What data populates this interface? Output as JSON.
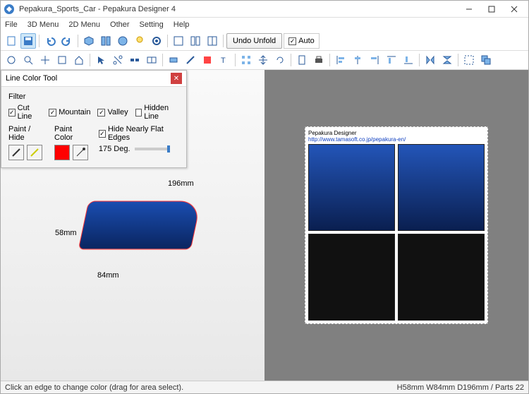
{
  "window": {
    "title": "Pepakura_Sports_Car - Pepakura Designer 4"
  },
  "menu": {
    "file": "File",
    "menu3d": "3D Menu",
    "menu2d": "2D Menu",
    "other": "Other",
    "setting": "Setting",
    "help": "Help"
  },
  "toolbar": {
    "undo_unfold": "Undo Unfold",
    "auto": "Auto"
  },
  "panel": {
    "title": "Line Color Tool",
    "filter_label": "Filter",
    "cut_line": "Cut Line",
    "mountain": "Mountain",
    "valley": "Valley",
    "hidden_line": "Hidden Line",
    "paint_hide": "Paint / Hide",
    "paint_color": "Paint Color",
    "hide_nearly_flat": "Hide Nearly Flat Edges",
    "deg": "175 Deg."
  },
  "model": {
    "length": "196mm",
    "height": "58mm",
    "width": "84mm"
  },
  "sheet": {
    "header": "Pepakura Designer",
    "link": "http://www.tamasoft.co.jp/pepakura-en/"
  },
  "status": {
    "left": "Click an edge to change color (drag for area select).",
    "right": "H58mm W84mm D196mm / Parts 22"
  }
}
